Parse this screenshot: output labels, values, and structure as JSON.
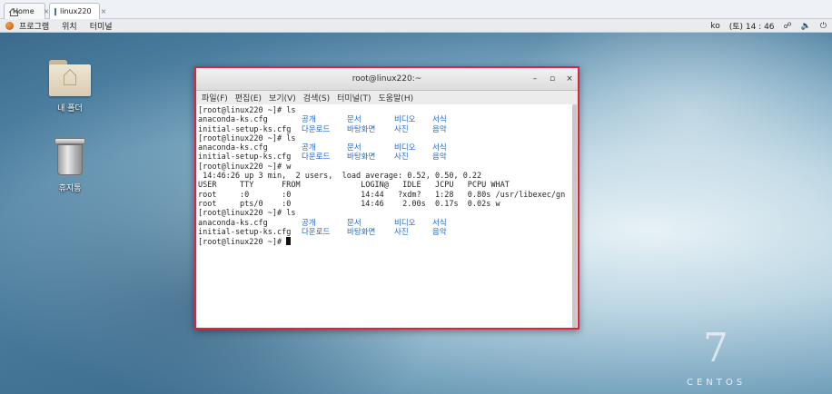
{
  "host_tabs": [
    {
      "label": "Home",
      "close": "×"
    },
    {
      "label": "linux220",
      "close": "×"
    }
  ],
  "topbar": {
    "menu": [
      "프로그램",
      "위치",
      "터미널"
    ],
    "ime": "ko",
    "clock": "(토) 14 : 46"
  },
  "desktop": {
    "icons": [
      {
        "label": "내 폴더"
      },
      {
        "label": "휴지통"
      }
    ],
    "brand_number": "7",
    "brand_word": "CENTOS"
  },
  "window": {
    "title": "root@linux220:~",
    "menu": [
      "파일(F)",
      "편집(E)",
      "보기(V)",
      "검색(S)",
      "터미널(T)",
      "도움말(H)"
    ],
    "buttons": {
      "minimize": "–",
      "maximize": "▫",
      "close": "×"
    }
  },
  "terminal": {
    "lines": [
      "[root@linux220 ~]# ls",
      "LS1",
      "LS2",
      "[root@linux220 ~]# ls",
      "LS1",
      "LS2",
      "[root@linux220 ~]# w",
      " 14:46:26 up 3 min,  2 users,  load average: 0.52, 0.50, 0.22",
      "USER     TTY      FROM             LOGIN@   IDLE   JCPU   PCPU WHAT",
      "root     :0       :0               14:44   ?xdm?   1:28   0.80s /usr/libexec/gn",
      "root     pts/0    :0               14:46    2.00s  0.17s  0.02s w",
      "[root@linux220 ~]# ls",
      "LS1",
      "LS2",
      "[root@linux220 ~]# "
    ],
    "ls_row1": {
      "file": "anaconda-ks.cfg",
      "dirs": [
        "공개",
        "문서",
        "비디오",
        "서식"
      ]
    },
    "ls_row2": {
      "file": "initial-setup-ks.cfg",
      "dirs": [
        "다운로드",
        "바탕화면",
        "사진",
        "음악"
      ]
    }
  },
  "colors": {
    "window_highlight": "#d7263d",
    "dir_blue": "#2169c7"
  }
}
